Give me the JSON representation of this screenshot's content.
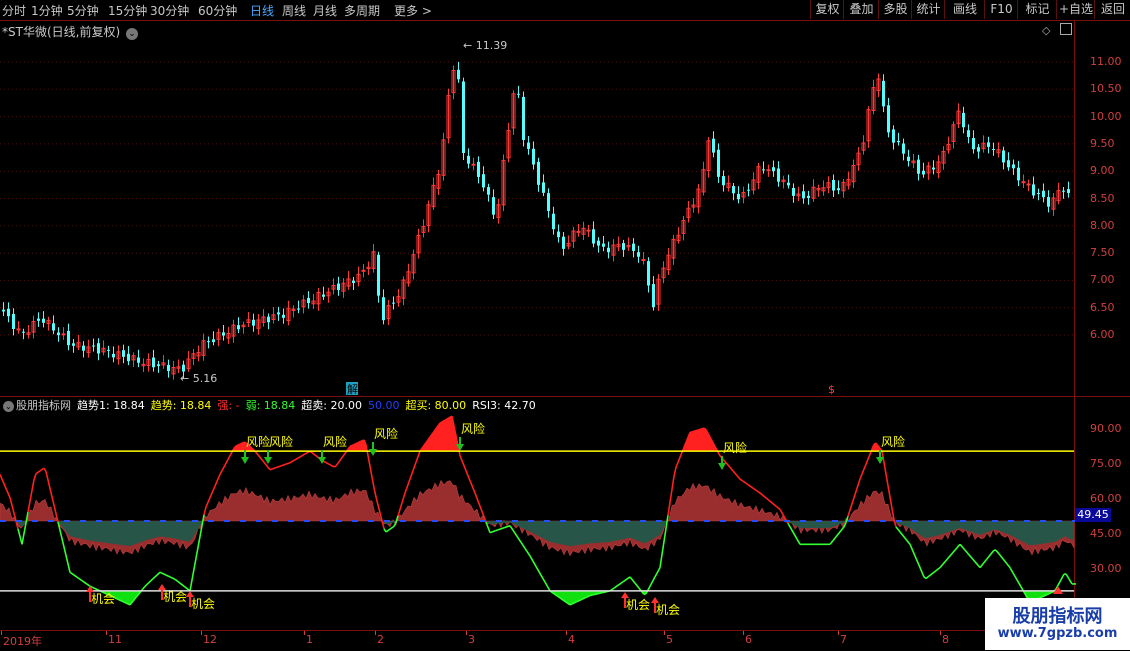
{
  "periods": [
    "分时",
    "1分钟",
    "5分钟",
    "15分钟",
    "30分钟",
    "60分钟",
    "日线",
    "周线",
    "月线",
    "多周期",
    "更多 >"
  ],
  "active_period": "日线",
  "right_buttons": [
    "复权",
    "叠加",
    "多股",
    "统计",
    "画线",
    "F10",
    "标记",
    "+自选",
    "返回"
  ],
  "title": "*ST华微(日线,前复权)",
  "indicator": {
    "name": "股朋指标网",
    "items": [
      {
        "label": "趋势1: 18.84",
        "color": "#ffffff"
      },
      {
        "label": "趋势: 18.84",
        "color": "#ffff00"
      },
      {
        "label": "强: -",
        "color": "#ff3030"
      },
      {
        "label": "弱: 18.84",
        "color": "#30ff30"
      },
      {
        "label": "超卖: 20.00",
        "color": "#ffffff"
      },
      {
        "label": "50.00",
        "color": "#2040ff"
      },
      {
        "label": "超买: 80.00",
        "color": "#ffff00"
      },
      {
        "label": "RSI3: 42.70",
        "color": "#ffffff"
      }
    ]
  },
  "price_axis": [
    "11.00",
    "10.50",
    "10.00",
    "9.50",
    "9.00",
    "8.50",
    "8.00",
    "7.50",
    "7.00",
    "6.50",
    "6.00"
  ],
  "rsi_axis": [
    "90.00",
    "75.00",
    "60.00",
    "45.00",
    "30.00"
  ],
  "current_rsi": "49.45",
  "high_label": "11.39",
  "low_label": "5.16",
  "jie_label": "解",
  "s_label": "$",
  "dates": [
    "2019年",
    "11",
    "12",
    "1",
    "2",
    "3",
    "4",
    "5",
    "6",
    "7",
    "8"
  ],
  "risk_label": "风险",
  "chance_label": "机会",
  "watermark": {
    "line1": "股朋指标网",
    "line2": "www.7gpzb.com"
  },
  "colors": {
    "up": "#ff3838",
    "down": "#54ffff",
    "red_border": "#7a1010",
    "yellow": "#ffff00",
    "green": "#00ff00",
    "histo": "#a03030"
  }
}
